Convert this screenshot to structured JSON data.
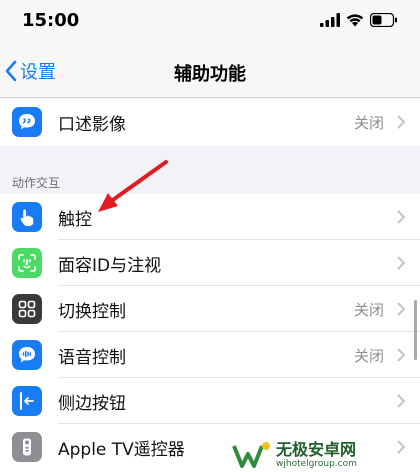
{
  "status_bar": {
    "time": "15:00"
  },
  "nav": {
    "back_label": "设置",
    "title": "辅助功能"
  },
  "rows_top": [
    {
      "label": "口述影像",
      "value": "关闭"
    }
  ],
  "section": {
    "header": "动作交互"
  },
  "rows": [
    {
      "label": "触控",
      "value": ""
    },
    {
      "label": "面容ID与注视",
      "value": ""
    },
    {
      "label": "切换控制",
      "value": "关闭"
    },
    {
      "label": "语音控制",
      "value": "关闭"
    },
    {
      "label": "侧边按钮",
      "value": ""
    },
    {
      "label": "Apple TV遥控器",
      "value": ""
    }
  ],
  "colors": {
    "accent": "#1a7cf5",
    "icon_blue": "#1a7cf5",
    "icon_green": "#4cd964",
    "icon_dark": "#3a3a3c",
    "icon_gray": "#8e8e93",
    "arrow": "#e11b22"
  },
  "watermark": {
    "title": "无极安卓网",
    "url": "wjhotelgroup.com"
  }
}
